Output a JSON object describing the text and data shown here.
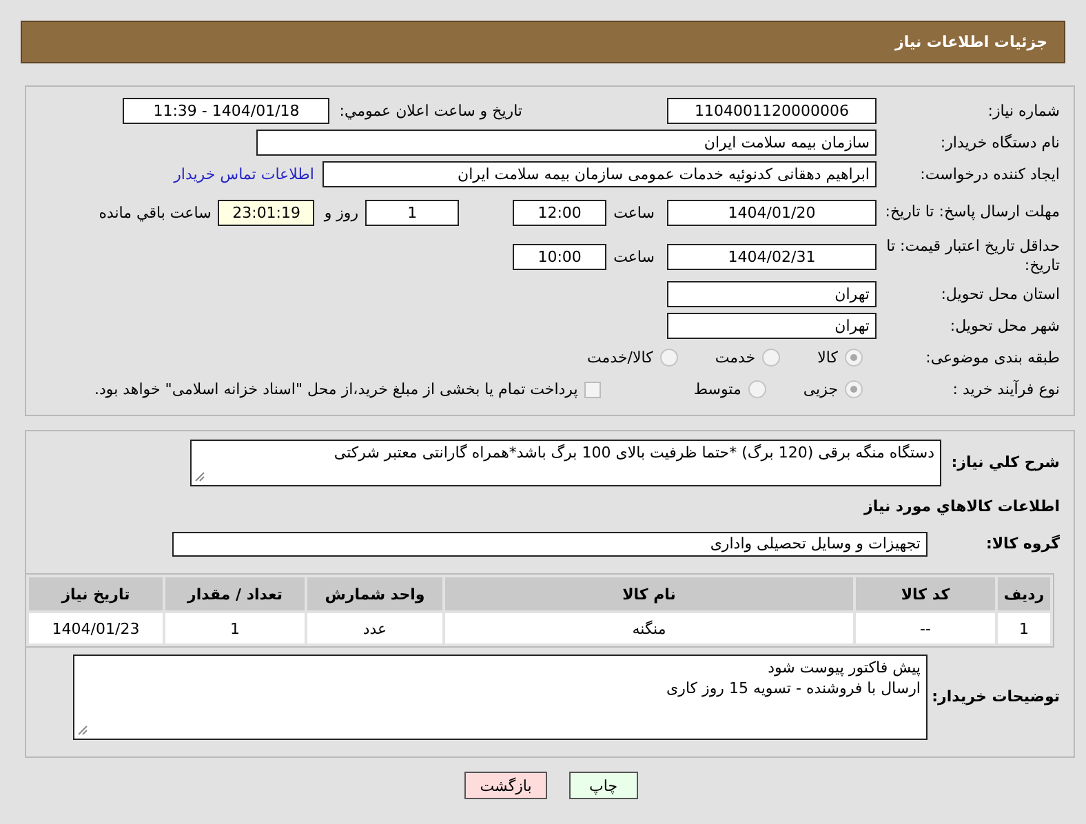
{
  "header": {
    "title": "جزئیات اطلاعات نیاز"
  },
  "need_number": {
    "label": "شماره نیاز:",
    "value": "1104001120000006"
  },
  "announce": {
    "label": "تاریخ و ساعت اعلان عمومي:",
    "value": "1404/01/18 - 11:39"
  },
  "buyer_org": {
    "label": "نام دستگاه خریدار:",
    "value": "سازمان بیمه سلامت ایران"
  },
  "requester": {
    "label": "ایجاد کننده درخواست:",
    "value": "ابراهیم دهقانی کدنوئیه خدمات عمومی سازمان بیمه سلامت ایران",
    "link": "اطلاعات تماس خریدار"
  },
  "deadline": {
    "label": "مهلت ارسال پاسخ: تا تاریخ:",
    "date": "1404/01/20",
    "time_label": "ساعت",
    "time": "12:00",
    "days": "1",
    "days_label": "روز و",
    "remaining": "23:01:19",
    "remaining_label": "ساعت باقي مانده"
  },
  "price_validity": {
    "label": "حداقل تاریخ اعتبار قیمت: تا تاریخ:",
    "date": "1404/02/31",
    "time_label": "ساعت",
    "time": "10:00"
  },
  "province": {
    "label": "استان محل تحویل:",
    "value": "تهران"
  },
  "city": {
    "label": "شهر محل تحویل:",
    "value": "تهران"
  },
  "category": {
    "label": "طبقه بندی موضوعی:",
    "options": [
      {
        "label": "کالا",
        "selected": true
      },
      {
        "label": "خدمت",
        "selected": false
      },
      {
        "label": "کالا/خدمت",
        "selected": false
      }
    ]
  },
  "process": {
    "label": "نوع فرآیند خرید :",
    "options": [
      {
        "label": "جزیی",
        "selected": true
      },
      {
        "label": "متوسط",
        "selected": false
      }
    ],
    "treasury": {
      "label": "پرداخت تمام یا بخشی از مبلغ خرید،از محل \"اسناد خزانه اسلامی\" خواهد بود.",
      "checked": false
    }
  },
  "description": {
    "label": "شرح کلي نياز:",
    "value": "دستگاه منگه برقی (120 برگ) *حتما ظرفیت بالای 100 برگ باشد*همراه گارانتی معتبر شرکتی"
  },
  "goods_heading": "اطلاعات کالاهاي مورد نياز",
  "goods_group": {
    "label": "گروه کالا:",
    "value": "تجهیزات و وسایل تحصیلی واداری"
  },
  "table": {
    "columns": [
      "ردیف",
      "کد کالا",
      "نام کالا",
      "واحد شمارش",
      "تعداد / مقدار",
      "تاریخ نیاز"
    ],
    "rows": [
      [
        "1",
        "--",
        "منگنه",
        "عدد",
        "1",
        "1404/01/23"
      ]
    ]
  },
  "buyer_notes": {
    "label": "توضیحات خریدار:",
    "lines": [
      "پیش فاکتور پیوست شود",
      "ارسال با فروشنده - تسویه 15 روز کاری"
    ]
  },
  "buttons": [
    {
      "label": "چاپ",
      "kind": "print"
    },
    {
      "label": "بازگشت",
      "kind": "back"
    }
  ]
}
